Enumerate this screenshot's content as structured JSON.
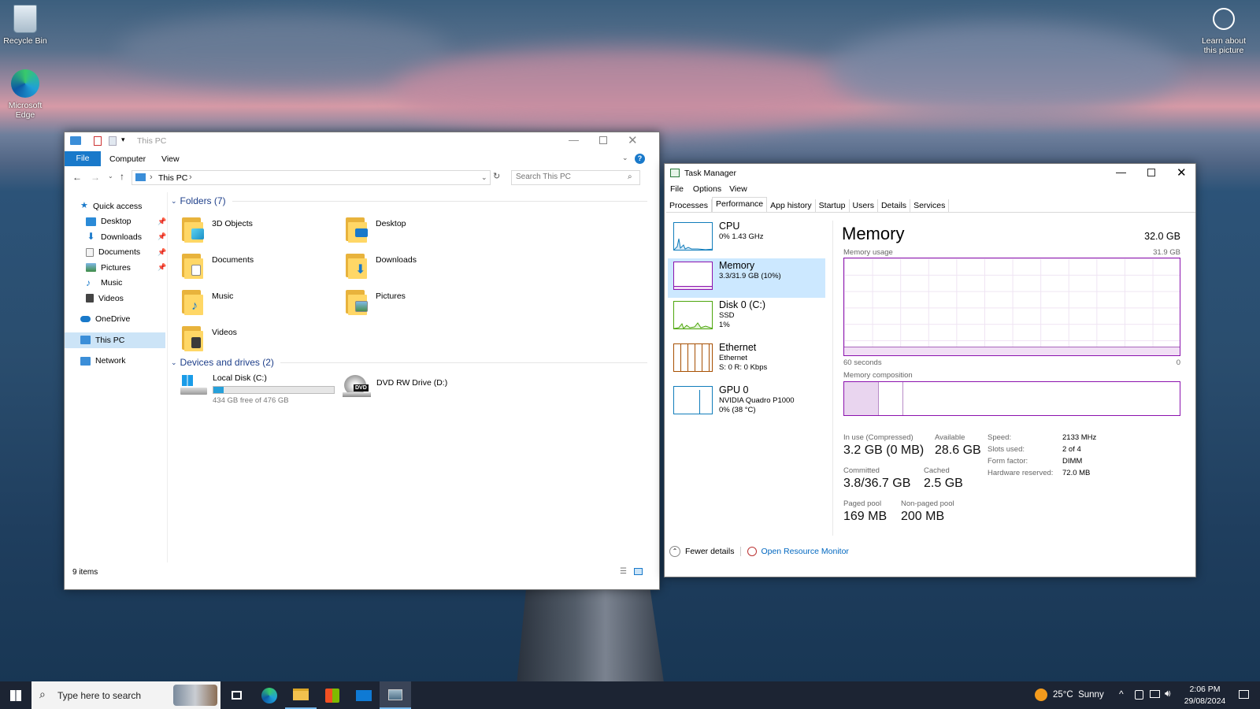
{
  "desktop": {
    "recycle_bin": "Recycle Bin",
    "edge_line1": "Microsoft",
    "edge_line2": "Edge",
    "learn_line1": "Learn about",
    "learn_line2": "this picture"
  },
  "explorer": {
    "title": "This PC",
    "ribbon_tabs": [
      "File",
      "Computer",
      "View"
    ],
    "address": "This PC",
    "search_placeholder": "Search This PC",
    "nav": {
      "quick_access": "Quick access",
      "desktop": "Desktop",
      "downloads": "Downloads",
      "documents": "Documents",
      "pictures": "Pictures",
      "music": "Music",
      "videos": "Videos",
      "onedrive": "OneDrive",
      "this_pc": "This PC",
      "network": "Network"
    },
    "folders_header": "Folders (7)",
    "folders": [
      "3D Objects",
      "Desktop",
      "Documents",
      "Downloads",
      "Music",
      "Pictures",
      "Videos"
    ],
    "drives_header": "Devices and drives (2)",
    "drive_c": {
      "name": "Local Disk (C:)",
      "free": "434 GB free of 476 GB",
      "used_fraction": 0.088
    },
    "drive_d": {
      "name": "DVD RW Drive (D:)",
      "badge": "DVD"
    },
    "status": "9 items"
  },
  "taskmgr": {
    "title": "Task Manager",
    "menu": [
      "File",
      "Options",
      "View"
    ],
    "tabs": [
      "Processes",
      "Performance",
      "App history",
      "Startup",
      "Users",
      "Details",
      "Services"
    ],
    "side": {
      "cpu": {
        "title": "CPU",
        "sub": "0% 1.43 GHz"
      },
      "memory": {
        "title": "Memory",
        "sub": "3.3/31.9 GB (10%)"
      },
      "disk": {
        "title": "Disk 0 (C:)",
        "sub1": "SSD",
        "sub2": "1%"
      },
      "ethernet": {
        "title": "Ethernet",
        "sub1": "Ethernet",
        "sub2": "S: 0 R: 0 Kbps"
      },
      "gpu": {
        "title": "GPU 0",
        "sub1": "NVIDIA Quadro P1000",
        "sub2": "0% (38 °C)"
      }
    },
    "main": {
      "heading": "Memory",
      "total": "32.0 GB",
      "usage_label": "Memory usage",
      "usage_max": "31.9 GB",
      "time_left": "60 seconds",
      "time_right": "0",
      "composition_label": "Memory composition",
      "in_use_label": "In use (Compressed)",
      "in_use_value": "3.2 GB (0 MB)",
      "available_label": "Available",
      "available_value": "28.6 GB",
      "committed_label": "Committed",
      "committed_value": "3.8/36.7 GB",
      "cached_label": "Cached",
      "cached_value": "2.5 GB",
      "paged_label": "Paged pool",
      "paged_value": "169 MB",
      "nonpaged_label": "Non-paged pool",
      "nonpaged_value": "200 MB",
      "speed_label": "Speed:",
      "speed_value": "2133 MHz",
      "slots_label": "Slots used:",
      "slots_value": "2 of 4",
      "form_label": "Form factor:",
      "form_value": "DIMM",
      "hwres_label": "Hardware reserved:",
      "hwres_value": "72.0 MB"
    },
    "fewer_details": "Fewer details",
    "open_resmon": "Open Resource Monitor"
  },
  "taskbar": {
    "search_placeholder": "Type here to search",
    "weather": "25°C  Sunny",
    "time": "2:06 PM",
    "date": "29/08/2024"
  },
  "colors": {
    "accent": "#0067c0",
    "memory": "#8b12ae",
    "cpu": "#117dbb",
    "disk": "#4da60c",
    "ethernet": "#a74f01",
    "taskbar": "#1c2433"
  }
}
